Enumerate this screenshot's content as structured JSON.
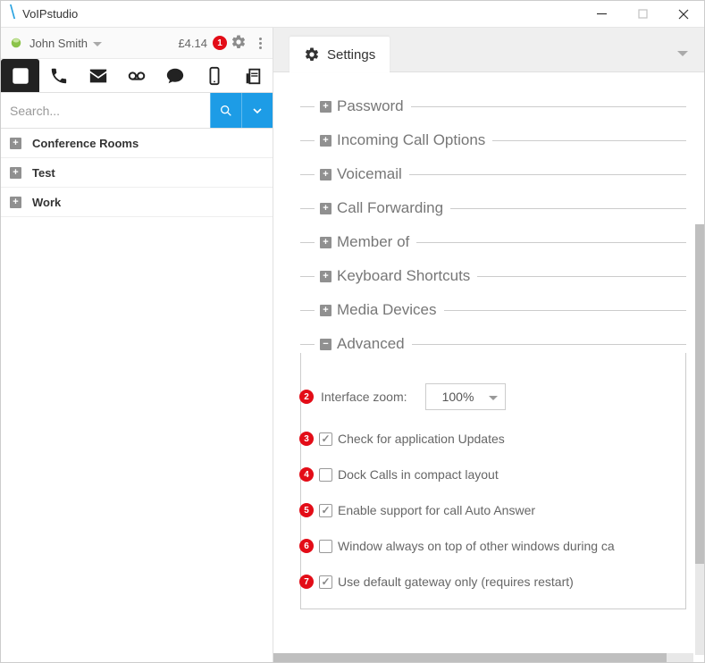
{
  "app": {
    "title": "VoIPstudio"
  },
  "user": {
    "name": "John Smith",
    "balance": "£4.14"
  },
  "callouts": {
    "c1": "1",
    "c2": "2",
    "c3": "3",
    "c4": "4",
    "c5": "5",
    "c6": "6",
    "c7": "7"
  },
  "search": {
    "placeholder": "Search..."
  },
  "groups": {
    "conference": "Conference Rooms",
    "test": "Test",
    "work": "Work"
  },
  "settings": {
    "tab": "Settings",
    "sections": {
      "password": "Password",
      "incoming": "Incoming Call Options",
      "voicemail": "Voicemail",
      "forwarding": "Call Forwarding",
      "memberof": "Member of",
      "shortcuts": "Keyboard Shortcuts",
      "media": "Media Devices",
      "advanced": "Advanced"
    },
    "advanced": {
      "zoom_label": "Interface zoom:",
      "zoom_value": "100%",
      "check_updates": "Check for application Updates",
      "dock_calls": "Dock Calls in compact layout",
      "auto_answer": "Enable support for call Auto Answer",
      "always_on_top": "Window always on top of other windows during ca",
      "default_gateway": "Use default gateway only (requires restart)"
    }
  }
}
